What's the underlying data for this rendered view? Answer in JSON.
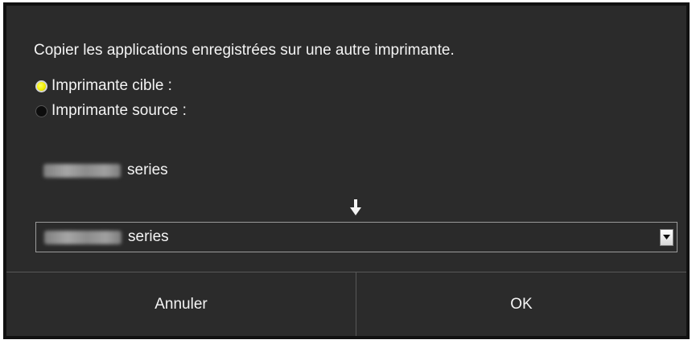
{
  "dialog": {
    "instruction": "Copier les applications enregistrées sur une autre imprimante.",
    "radio_options": [
      {
        "label": "Imprimante cible :",
        "selected": true
      },
      {
        "label": "Imprimante source :",
        "selected": false
      }
    ],
    "source_printer": {
      "series_label": "series"
    },
    "target_select": {
      "selected_value": "series"
    },
    "arrow_icon": "down-arrow-icon",
    "buttons": {
      "cancel_label": "Annuler",
      "ok_label": "OK"
    }
  },
  "colors": {
    "background": "#2b2b2b",
    "text": "#f4f4f4",
    "radio_selected": "#f4f000",
    "border": "#585858"
  }
}
